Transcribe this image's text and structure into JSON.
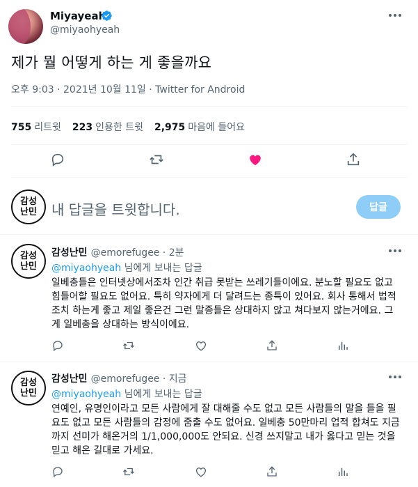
{
  "tweet": {
    "author_name": "Miyayeah",
    "author_handle": "@miyaohyeah",
    "text": "제가 뭘 어떻게 하는 게 좋을까요",
    "meta": "오후 9:03 · 2021년 10월 11일 · Twitter for Android",
    "stats": {
      "retweets": "755",
      "retweets_label": "리트윗",
      "quotes": "223",
      "quotes_label": "인용한 트윗",
      "likes": "2,975",
      "likes_label": "마음에 들어요"
    },
    "liked": true
  },
  "compose": {
    "avatar_text": "감성\n난민",
    "placeholder": "내 답글을 트윗합니다.",
    "reply_button": "답글"
  },
  "replies": [
    {
      "avatar_text": "감성\n난민",
      "name": "감성난민",
      "handle_time": "@emorefugee · 2분",
      "mention": "@miyaohyeah",
      "replying_suffix": " 님에게 보내는 답글",
      "text": "일베충들은 인터넷상에서조차 인간 취급 못받는 쓰레기들이에요. 분노할 필요도 없고 힘들어할 필요도 없어요. 특히 약자에게 더 달려드는 종특이 있어요. 회사 통해서 법적 조치 하는게 좋고 제일 좋은건 그런 말종들은 상대하지 않고 쳐다보지 않는거에요. 그게 일베충을 상대하는 방식이에요."
    },
    {
      "avatar_text": "감성\n난민",
      "name": "감성난민",
      "handle_time": "@emorefugee · 지금",
      "mention": "@miyaohyeah",
      "replying_suffix": " 님에게 보내는 답글",
      "text": "연예인, 유명인이라고 모든 사람에게 잘 대해줄 수도 없고 모든 사람들의 말을 들을 필요도 없고 모든 사람들의 감정에 줌출 수도 없어요. 일베충 50만마리 업적 합쳐도 지금까지 선미가 해온거의 1/1,000,000도 안되요. 신경 쓰지말고 내가 옳다고 믿는 것을 믿고 해온 길대로 가세요."
    }
  ],
  "colors": {
    "accent": "#1d9bf0",
    "like": "#f91880",
    "secondary_text": "#536471",
    "divider": "#eff3f4",
    "reply_button_bg": "#8ecdf8"
  },
  "icons": [
    "verified-icon",
    "more-icon",
    "reply-icon",
    "retweet-icon",
    "like-icon",
    "share-icon",
    "analytics-icon"
  ]
}
